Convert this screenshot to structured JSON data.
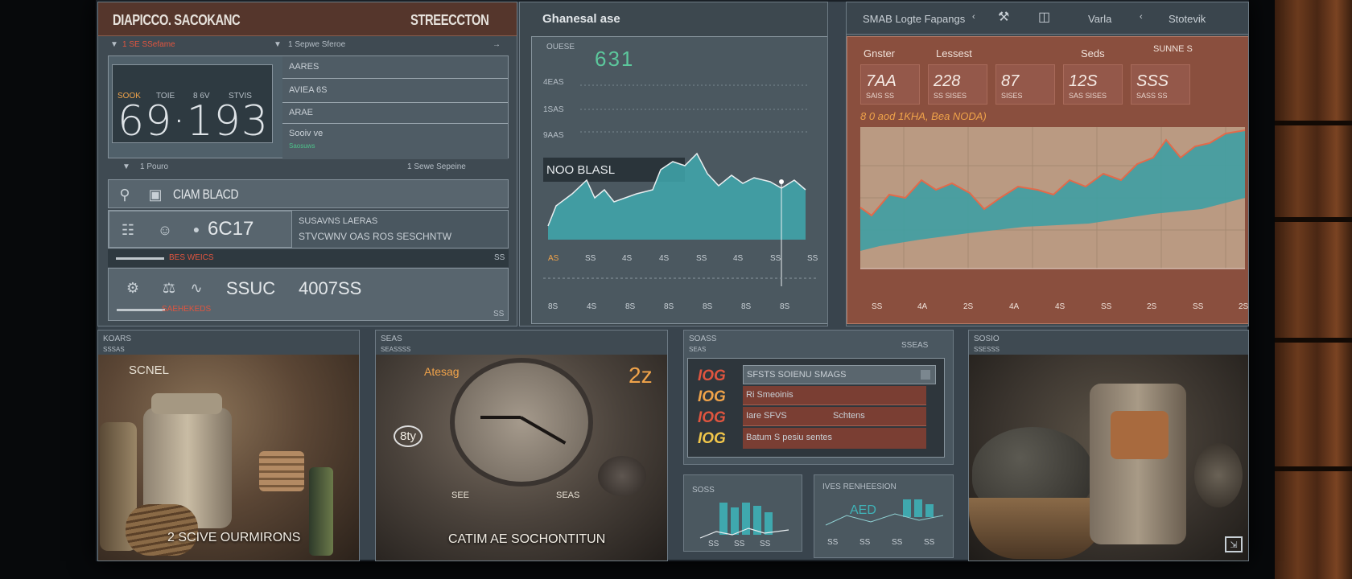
{
  "header": {
    "left_title": "DIAPICCO. SACOKANC",
    "center_title": "STREECCTON",
    "chart_title": "Ghanesal ase",
    "right_nav": [
      "SMAB Logte Fapangs",
      "Varla",
      "Stotevik"
    ]
  },
  "left_panel": {
    "sub_header_left": "1 SE SSefame",
    "sub_header_right": "1 Sepwe Sferoe",
    "big_labels": [
      "SOOK",
      "TOIE",
      "8 6V",
      "STVIS"
    ],
    "big_number": "69·193",
    "list_items": [
      "AARES",
      "AVIEA 6S",
      "ARAE",
      "Sooiv ve"
    ],
    "list_sub": "Saosuws",
    "section2_left": "1 Pouro",
    "section2_right": "1 Sewe Sepeine",
    "claim_label": "CIAM BLACD",
    "metric_value": "6C17",
    "sensor_lines": [
      "SUSAVNS LAERAS",
      "STVCWNV OAS ROS SESCHNTW"
    ],
    "warning": "BES WEICS",
    "warning_code": "SS",
    "bottom_value": "SSUC",
    "bottom_metric": "4007SS",
    "bottom_warning": "SAEHEKEDS",
    "bottom_code": "SS"
  },
  "center_chart": {
    "value_label": "OUESE",
    "value": "631",
    "y_labels": [
      "4EAS",
      "1SAS",
      "9AAS"
    ],
    "badge": "NOO BLASL",
    "x_labels": [
      "AS",
      "SS",
      "4S",
      "4S",
      "SS",
      "4S",
      "SS",
      "SS"
    ],
    "x_labels_bottom": [
      "8S",
      "4S",
      "8S",
      "8S",
      "8S",
      "8S",
      "8S"
    ]
  },
  "right_chart": {
    "headers": [
      "Gnster",
      "Lessest",
      "Seds",
      "SUNNE S"
    ],
    "stats": [
      {
        "value": "7AA",
        "sub": "SAIS SS"
      },
      {
        "value": "228",
        "sub": "SS SISES"
      },
      {
        "value": "87",
        "sub": "SISES"
      },
      {
        "value": "12S",
        "sub": "SAS SISES"
      },
      {
        "value": "SSS",
        "sub": "SASS SS"
      }
    ],
    "subtitle": "8 0 aod 1KHA, Bea NODA)",
    "x_labels": [
      "SS",
      "4A",
      "2S",
      "4A",
      "4S",
      "SS",
      "2S",
      "SS",
      "2S"
    ]
  },
  "bottom_panels": {
    "p1": {
      "title": "KOARS",
      "sub": "SSSAS",
      "label": "SCNEL",
      "caption": "2 SCIVE OURMIRONS"
    },
    "p2": {
      "title": "SEAS",
      "sub": "SEASSSS",
      "label": "Atesag",
      "num": "2z",
      "badge": "8ty",
      "tag": "SEE",
      "tag2": "SEAS",
      "caption": "CATIM AE SOCHONTITUN"
    },
    "p3": {
      "title": "SOASS",
      "sub": "SEAS",
      "right_sub": "SSEAS",
      "header": "SFSTS SOIENU SMAGS",
      "rows": [
        "Ri Smeoinis",
        "Iare SFVS",
        "Batum S pesiu sentes"
      ],
      "row_extra": "Schtens",
      "labels": [
        "IOG",
        "IOG",
        "IOG",
        "IOG"
      ]
    },
    "p3_small": {
      "left_title": "SOSS",
      "left_x": [
        "SS",
        "SS",
        "SS"
      ],
      "right_title": "IVES RENHEESION",
      "right_label": "AED",
      "right_x": [
        "SS",
        "SS",
        "SS",
        "SS"
      ]
    },
    "p4": {
      "title": "SOSIO",
      "sub": "SSESSS"
    }
  },
  "colors": {
    "teal": "#3f9ea3",
    "accent_red": "#e0553f",
    "panel": "#46525b",
    "brown": "#8a4f3e"
  }
}
